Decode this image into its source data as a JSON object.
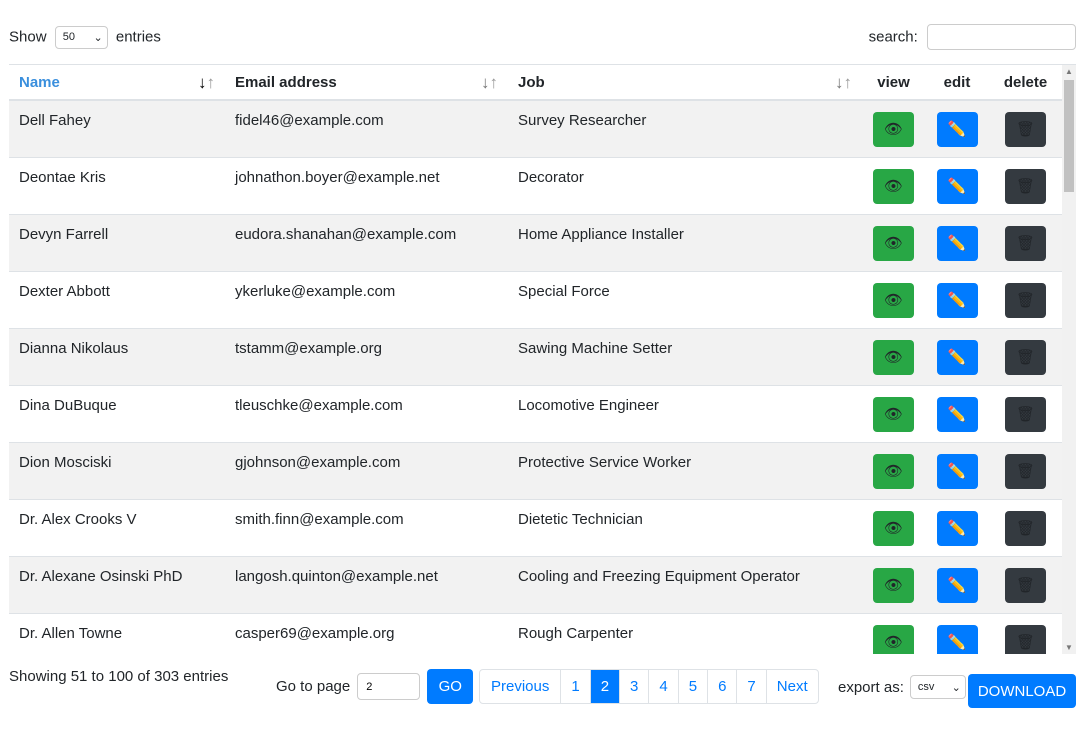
{
  "controls": {
    "show_label": "Show",
    "entries_value": "50",
    "entries_label": "entries",
    "search_label": "search:",
    "search_value": ""
  },
  "columns": {
    "name": "Name",
    "email": "Email address",
    "job": "Job",
    "view": "view",
    "edit": "edit",
    "delete": "delete"
  },
  "icons": {
    "sort": "sort-arrows-icon",
    "view": "eye-icon",
    "edit": "pencil-icon",
    "delete": "wastebasket-icon"
  },
  "colors": {
    "view": "#28a745",
    "edit": "#007bff",
    "delete": "#343a40",
    "accent": "#007bff"
  },
  "rows": [
    {
      "name": "Dell Fahey",
      "email": "fidel46@example.com",
      "job": "Survey Researcher"
    },
    {
      "name": "Deontae Kris",
      "email": "johnathon.boyer@example.net",
      "job": "Decorator"
    },
    {
      "name": "Devyn Farrell",
      "email": "eudora.shanahan@example.com",
      "job": "Home Appliance Installer"
    },
    {
      "name": "Dexter Abbott",
      "email": "ykerluke@example.com",
      "job": "Special Force"
    },
    {
      "name": "Dianna Nikolaus",
      "email": "tstamm@example.org",
      "job": "Sawing Machine Setter"
    },
    {
      "name": "Dina DuBuque",
      "email": "tleuschke@example.com",
      "job": "Locomotive Engineer"
    },
    {
      "name": "Dion Mosciski",
      "email": "gjohnson@example.com",
      "job": "Protective Service Worker"
    },
    {
      "name": "Dr. Alex Crooks V",
      "email": "smith.finn@example.com",
      "job": "Dietetic Technician"
    },
    {
      "name": "Dr. Alexane Osinski PhD",
      "email": "langosh.quinton@example.net",
      "job": "Cooling and Freezing Equipment Operator"
    },
    {
      "name": "Dr. Allen Towne",
      "email": "casper69@example.org",
      "job": "Rough Carpenter"
    }
  ],
  "footer": {
    "info": "Showing 51 to 100 of 303 entries",
    "goto_label": "Go to page",
    "goto_value": "2",
    "go_button": "GO",
    "previous": "Previous",
    "pages": [
      "1",
      "2",
      "3",
      "4",
      "5",
      "6",
      "7"
    ],
    "current_page": "2",
    "next": "Next",
    "export_label": "export as:",
    "export_value": "csv",
    "download": "DOWNLOAD"
  }
}
